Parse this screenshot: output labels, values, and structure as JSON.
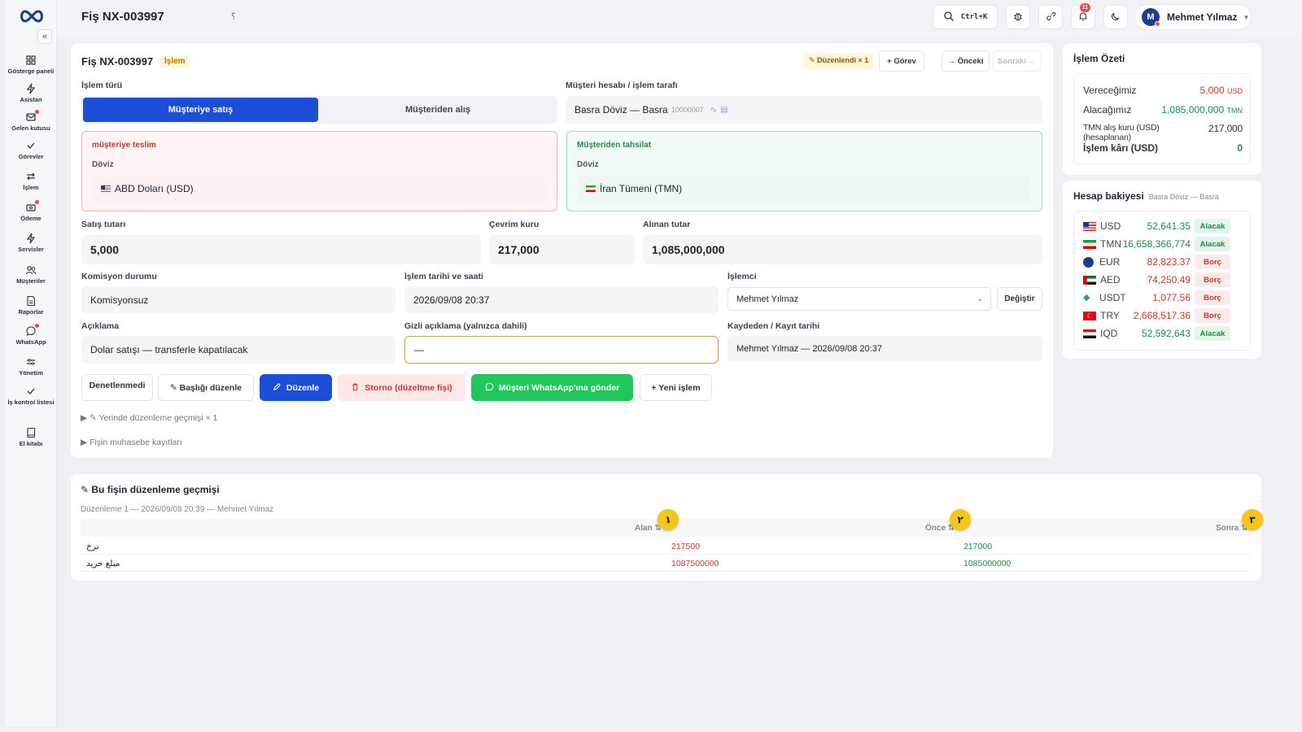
{
  "sidebar": {
    "collapse": "«",
    "items": [
      {
        "label": "Gösterge paneli",
        "icon": "grid-icon"
      },
      {
        "label": "Asistan",
        "icon": "bolt-icon"
      },
      {
        "label": "Gelen kutusu",
        "icon": "inbox-icon"
      },
      {
        "label": "Görevler",
        "icon": "check-icon"
      },
      {
        "label": "İşlem",
        "icon": "transfer-icon"
      },
      {
        "label": "Ödeme",
        "icon": "wallet-icon"
      },
      {
        "label": "Servisler",
        "icon": "bolt-icon"
      },
      {
        "label": "Müşteriler",
        "icon": "users-icon"
      },
      {
        "label": "Raporlar",
        "icon": "report-icon"
      },
      {
        "label": "WhatsApp",
        "icon": "chat-icon"
      },
      {
        "label": "Yönetim",
        "icon": "sliders-icon"
      },
      {
        "label": "İş kontrol listesi",
        "icon": "check-icon"
      },
      {
        "label": "El kitabı",
        "icon": "book-icon"
      }
    ]
  },
  "topbar": {
    "title": "Fiş NX-003997",
    "title_info": "؟",
    "search_shortcut": "Ctrl+K",
    "notifications_count": "11",
    "user": {
      "initial": "M",
      "name": "Mehmet Yılmaz"
    }
  },
  "main": {
    "title": "Fiş NX-003997",
    "tag": "İşlem",
    "edited_badge": "✎ Düzenlendi × 1",
    "task_button": "+ Görev",
    "prev_button": "→ Önceki",
    "next_button": "Sonraki ←",
    "tx_type_label": "İşlem türü",
    "tx_type_options": [
      "Müşteriye satış",
      "Müşteriden alış"
    ],
    "account_label": "Müşteri hesabı / işlem tarafı",
    "account_name": "Basra Döviz — Basra",
    "account_id": "10000007",
    "deliver": {
      "title": "müşteriye teslim",
      "sub": "Döviz",
      "currency": "ABD Doları (USD)"
    },
    "collect": {
      "title": "Müşteriden tahsilat",
      "sub": "Döviz",
      "currency": "İran Tümeni (TMN)"
    },
    "sale_amount_label": "Satış tutarı",
    "sale_amount": "5,000",
    "rate_label": "Çevrim kuru",
    "rate": "217,000",
    "received_label": "Alınan tutar",
    "received": "1,085,000,000",
    "commission_label": "Komisyon durumu",
    "commission": "Komisyonsuz",
    "datetime_label": "İşlem tarihi ve saati",
    "datetime": "2026/09/08 20:37",
    "operator_label": "İşlemci",
    "operator": "Mehmet Yılmaz",
    "change_button": "Değiştir",
    "desc_label": "Açıklama",
    "desc": "Dolar satışı — transferle kapatılacak",
    "hidden_desc_label": "Gizli açıklama (yalnızca dahili)",
    "hidden_desc": "—",
    "recorder_label": "Kaydeden / Kayıt tarihi",
    "recorder": "Mehmet Yılmaz — 2026/09/08 20:37",
    "actions": {
      "audit": "Denetlenmedi",
      "edit_title": "✎ Başlığı düzenle",
      "edit": "Düzenle",
      "storno": "Storno (düzeltme fişi)",
      "whatsapp": "Müşteri WhatsApp'ına gönder",
      "new_tx": "+ Yeni işlem"
    },
    "inline_history": "▶ ✎ Yerinde düzenleme geçmişi × 1",
    "accounting": "▶ Fişin muhasebe kayıtları"
  },
  "summary": {
    "title": "İşlem Özeti",
    "rows": [
      {
        "label": "Vereceğimiz",
        "value": "5,000",
        "unit": "USD"
      },
      {
        "label": "Alacağımız",
        "value": "1,085,000,000",
        "unit": "TMN"
      },
      {
        "label": "TMN alış kuru (USD) (hesaplanan)",
        "value": "217,000"
      },
      {
        "label": "İşlem kârı (USD)",
        "value": "0"
      }
    ]
  },
  "balance": {
    "title": "Hesap bakiyesi",
    "subtitle": "Basra Döviz — Basra",
    "rows": [
      {
        "cur": "USD",
        "amount": "52,641.35",
        "status": "Alacak"
      },
      {
        "cur": "TMN",
        "amount": "16,658,366,774",
        "status": "Alacak"
      },
      {
        "cur": "EUR",
        "amount": "82,823.37",
        "status": "Borç"
      },
      {
        "cur": "AED",
        "amount": "74,250.49",
        "status": "Borç"
      },
      {
        "cur": "USDT",
        "amount": "1,077.56",
        "status": "Borç"
      },
      {
        "cur": "TRY",
        "amount": "2,668,517.36",
        "status": "Borç"
      },
      {
        "cur": "IQD",
        "amount": "52,592,643",
        "status": "Alacak"
      }
    ]
  },
  "history": {
    "title": "✎ Bu fişin düzenleme geçmişi",
    "meta": "Düzenleme 1 — 2026/09/08 20:39 — Mehmet Yılmaz",
    "columns": [
      "Alan ⇅",
      "Önce ⇅",
      "Sonra ⇅"
    ],
    "markers": [
      "١",
      "٢",
      "٣"
    ],
    "rows": [
      {
        "field": "نرخ",
        "before": "217500",
        "after": "217000"
      },
      {
        "field": "مبلغ خرید",
        "before": "1087500000",
        "after": "1085000000"
      }
    ]
  }
}
